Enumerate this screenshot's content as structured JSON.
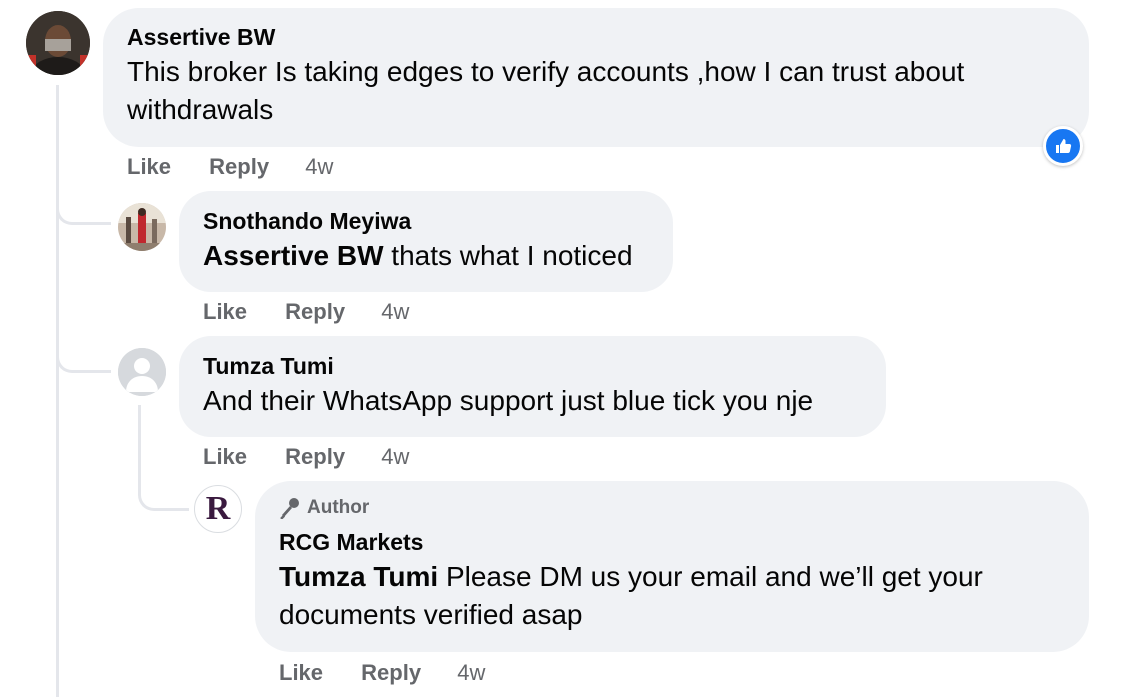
{
  "comments": [
    {
      "author": "Assertive BW",
      "text": "This broker Is taking edges to verify accounts ,how I can trust about withdrawals",
      "actions": {
        "like": "Like",
        "reply": "Reply",
        "time": "4w"
      }
    },
    {
      "author": "Snothando Meyiwa",
      "mention": "Assertive BW",
      "text": " thats what I noticed",
      "actions": {
        "like": "Like",
        "reply": "Reply",
        "time": "4w"
      }
    },
    {
      "author": "Tumza Tumi",
      "text": "And their WhatsApp support just blue tick you nje",
      "actions": {
        "like": "Like",
        "reply": "Reply",
        "time": "4w"
      }
    },
    {
      "badge": "Author",
      "author": "RCG Markets",
      "mention": "Tumza Tumi",
      "text": " Please DM us your email and we’ll get your documents verified asap",
      "actions": {
        "like": "Like",
        "reply": "Reply",
        "time": "4w"
      }
    }
  ],
  "rcg_logo_letter": "R",
  "colors": {
    "bubble": "#f0f2f5",
    "meta": "#65676b",
    "like_blue": "#1877f2"
  }
}
